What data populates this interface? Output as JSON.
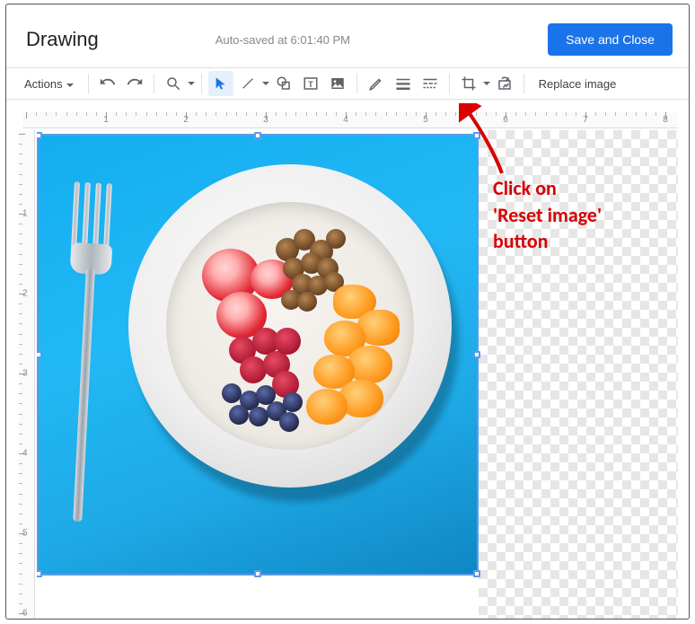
{
  "header": {
    "title": "Drawing",
    "autosave_text": "Auto-saved at 6:01:40 PM",
    "save_close_label": "Save and Close"
  },
  "toolbar": {
    "actions_label": "Actions",
    "replace_image_label": "Replace image"
  },
  "ruler": {
    "h_labels": [
      "1",
      "2",
      "3",
      "4",
      "5",
      "6",
      "7",
      "8"
    ],
    "v_labels": [
      "1",
      "2",
      "3",
      "4",
      "5",
      "6"
    ]
  },
  "annotation": {
    "text": "Click on\n'Reset image'\nbutton"
  },
  "colors": {
    "primary": "#1a73e8",
    "annotation_red": "#d90000",
    "photo_bg": "#22b8f5"
  }
}
